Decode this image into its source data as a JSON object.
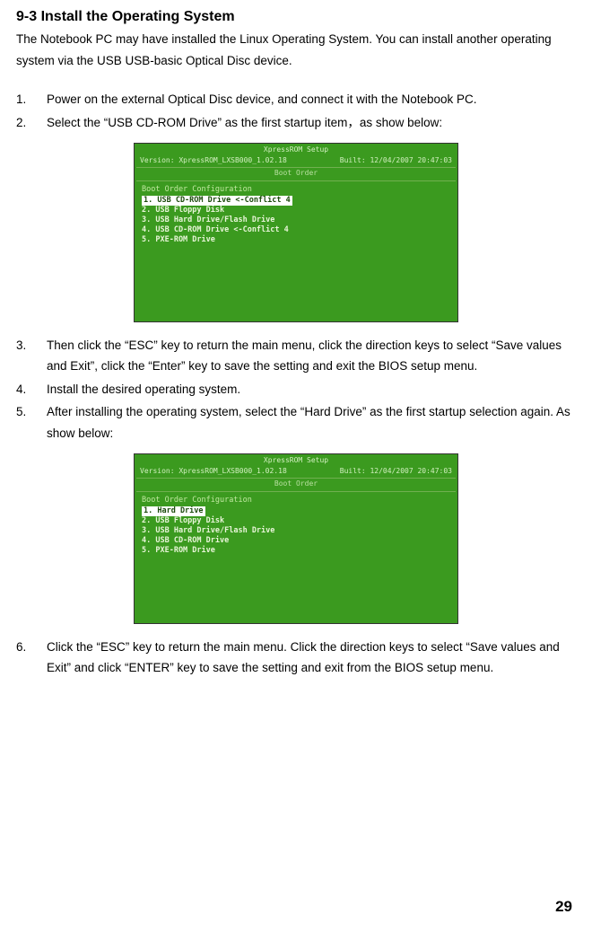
{
  "heading": "9-3 Install the Operating System",
  "intro": "The Notebook PC may have installed the Linux Operating System. You can install another operating system via the USB USB-basic Optical Disc device.",
  "steps": [
    {
      "num": "1.",
      "text": "Power on the external Optical Disc device, and connect it with the Notebook PC."
    },
    {
      "num": "2.",
      "text": "Select the “USB CD-ROM Drive” as the first startup item，as show below:"
    },
    {
      "num": "3.",
      "text": "Then click the “ESC” key to return the main menu, click the direction keys to select “Save values and Exit”, click the “Enter” key to save the setting and exit the BIOS setup menu."
    },
    {
      "num": "4.",
      "text": "Install the desired operating system."
    },
    {
      "num": "5.",
      "text": "After installing the operating system, select the “Hard Drive” as the first startup selection again. As show below:"
    },
    {
      "num": "6.",
      "text": "Click the “ESC” key to return the main menu. Click the direction keys to select “Save values and Exit” and click “ENTER” key to save the setting and exit from the BIOS setup menu."
    }
  ],
  "bios1": {
    "setup_title": "XpressROM Setup",
    "version": "Version: XpressROM_LXSB000_1.02.18",
    "built": "Built: 12/04/2007 20:47:03",
    "boot_order": "Boot Order",
    "config": "Boot Order Configuration",
    "highlight": "1. USB CD-ROM Drive <-Conflict 4",
    "items": [
      "2. USB Floppy Disk",
      "3. USB Hard Drive/Flash Drive",
      "4. USB CD-ROM Drive <-Conflict 4",
      "5. PXE-ROM Drive"
    ]
  },
  "bios2": {
    "setup_title": "XpressROM Setup",
    "version": "Version: XpressROM_LXSB000_1.02.18",
    "built": "Built: 12/04/2007 20:47:03",
    "boot_order": "Boot Order",
    "config": "Boot Order Configuration",
    "highlight": "1. Hard Drive",
    "items": [
      "2. USB Floppy Disk",
      "3. USB Hard Drive/Flash Drive",
      "4. USB CD-ROM Drive",
      "5. PXE-ROM Drive"
    ]
  },
  "page_number": "29"
}
